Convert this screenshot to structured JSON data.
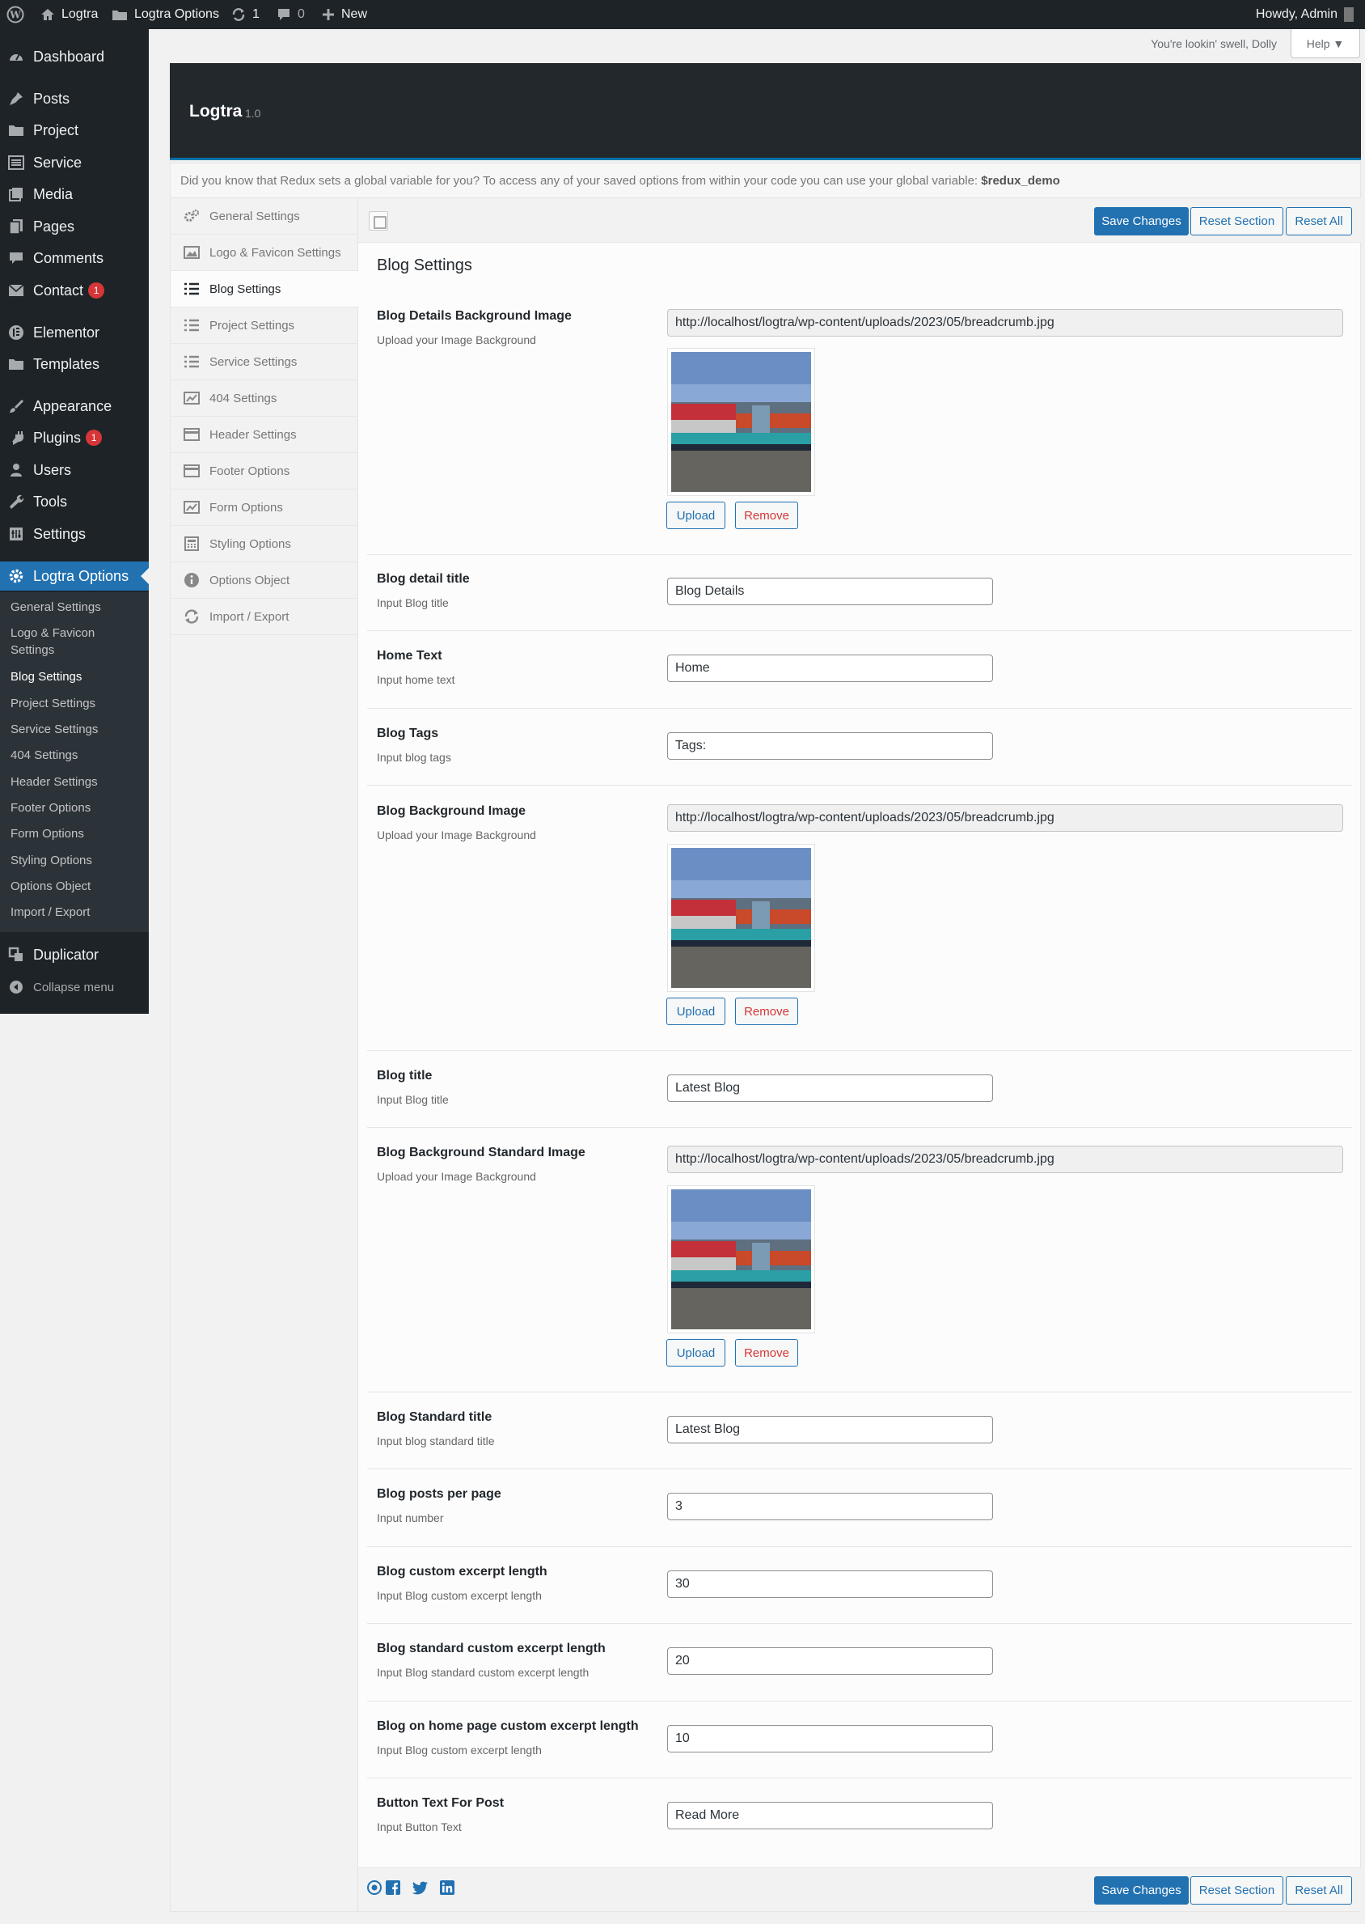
{
  "admin_bar": {
    "site_name": "Logtra",
    "options_link": "Logtra Options",
    "updates_count": "1",
    "comments_count": "0",
    "new_label": "New",
    "howdy": "Howdy, Admin"
  },
  "sidebar": {
    "items": [
      {
        "label": "Dashboard",
        "icon": "dashboard-icon"
      },
      {
        "label": "Posts",
        "icon": "pin-icon"
      },
      {
        "label": "Project",
        "icon": "folder-icon"
      },
      {
        "label": "Service",
        "icon": "list-icon"
      },
      {
        "label": "Media",
        "icon": "media-icon"
      },
      {
        "label": "Pages",
        "icon": "page-icon"
      },
      {
        "label": "Comments",
        "icon": "comment-icon"
      },
      {
        "label": "Contact",
        "icon": "mail-icon",
        "badge": "1"
      },
      {
        "label": "Elementor",
        "icon": "elementor-icon"
      },
      {
        "label": "Templates",
        "icon": "folder-icon"
      },
      {
        "label": "Appearance",
        "icon": "brush-icon"
      },
      {
        "label": "Plugins",
        "icon": "plug-icon",
        "badge": "1"
      },
      {
        "label": "Users",
        "icon": "user-icon"
      },
      {
        "label": "Tools",
        "icon": "wrench-icon"
      },
      {
        "label": "Settings",
        "icon": "settings-icon"
      },
      {
        "label": "Logtra Options",
        "icon": "gear-icon"
      },
      {
        "label": "Duplicator",
        "icon": "duplicator-icon"
      }
    ],
    "submenu": [
      "General Settings",
      "Logo & Favicon Settings",
      "Blog Settings",
      "Project Settings",
      "Service Settings",
      "404 Settings",
      "Header Settings",
      "Footer Options",
      "Form Options",
      "Styling Options",
      "Options Object",
      "Import / Export"
    ],
    "collapse_label": "Collapse menu"
  },
  "topline": {
    "dolly": "You're lookin' swell, Dolly",
    "help": "Help ▼"
  },
  "redux": {
    "title": "Logtra",
    "version": "1.0",
    "notice_text": "Did you know that Redux sets a global variable for you? To access any of your saved options from within your code you can use your global variable:",
    "notice_var": "$redux_demo",
    "menu": [
      {
        "label": "General Settings",
        "icon": "gears-icon"
      },
      {
        "label": "Logo & Favicon Settings",
        "icon": "image-icon"
      },
      {
        "label": "Blog Settings",
        "icon": "list-icon"
      },
      {
        "label": "Project Settings",
        "icon": "list-icon"
      },
      {
        "label": "Service Settings",
        "icon": "list-icon"
      },
      {
        "label": "404 Settings",
        "icon": "chart-icon"
      },
      {
        "label": "Header Settings",
        "icon": "credit-card-icon"
      },
      {
        "label": "Footer Options",
        "icon": "credit-card-icon"
      },
      {
        "label": "Form Options",
        "icon": "chart-icon"
      },
      {
        "label": "Styling Options",
        "icon": "calculator-icon"
      },
      {
        "label": "Options Object",
        "icon": "info-icon"
      },
      {
        "label": "Import / Export",
        "icon": "refresh-icon"
      }
    ],
    "buttons": {
      "save": "Save Changes",
      "reset_section": "Reset Section",
      "reset_all": "Reset All"
    }
  },
  "section_title": "Blog Settings",
  "fields": {
    "details_bg": {
      "title": "Blog Details Background Image",
      "subtitle": "Upload your Image Background",
      "value": "http://localhost/logtra/wp-content/uploads/2023/05/breadcrumb.jpg"
    },
    "detail_title": {
      "title": "Blog detail title",
      "subtitle": "Input Blog title",
      "value": "Blog Details"
    },
    "home_text": {
      "title": "Home Text",
      "subtitle": "Input home text",
      "value": "Home"
    },
    "blog_tags": {
      "title": "Blog Tags",
      "subtitle": "Input blog tags",
      "value": "Tags:"
    },
    "blog_bg": {
      "title": "Blog Background Image",
      "subtitle": "Upload your Image Background",
      "value": "http://localhost/logtra/wp-content/uploads/2023/05/breadcrumb.jpg"
    },
    "blog_title": {
      "title": "Blog title",
      "subtitle": "Input Blog title",
      "value": "Latest Blog"
    },
    "std_bg": {
      "title": "Blog Background Standard Image",
      "subtitle": "Upload your Image Background",
      "value": "http://localhost/logtra/wp-content/uploads/2023/05/breadcrumb.jpg"
    },
    "std_title": {
      "title": "Blog Standard title",
      "subtitle": "Input blog standard title",
      "value": "Latest Blog"
    },
    "per_page": {
      "title": "Blog posts per page",
      "subtitle": "Input number",
      "value": "3"
    },
    "excerpt": {
      "title": "Blog custom excerpt length",
      "subtitle": "Input Blog custom excerpt length",
      "value": "30"
    },
    "std_excerpt": {
      "title": "Blog standard custom excerpt length",
      "subtitle": "Input Blog standard custom excerpt length",
      "value": "20"
    },
    "home_excerpt": {
      "title": "Blog on home page custom excerpt length",
      "subtitle": "Input Blog custom excerpt length",
      "value": "10"
    },
    "button_text": {
      "title": "Button Text For Post",
      "subtitle": "Input Button Text",
      "value": "Read More"
    }
  },
  "media_buttons": {
    "upload": "Upload",
    "remove": "Remove"
  },
  "colors": {
    "accent": "#2271b1",
    "admin_dark": "#1d2327",
    "remove_red": "#d63638"
  }
}
